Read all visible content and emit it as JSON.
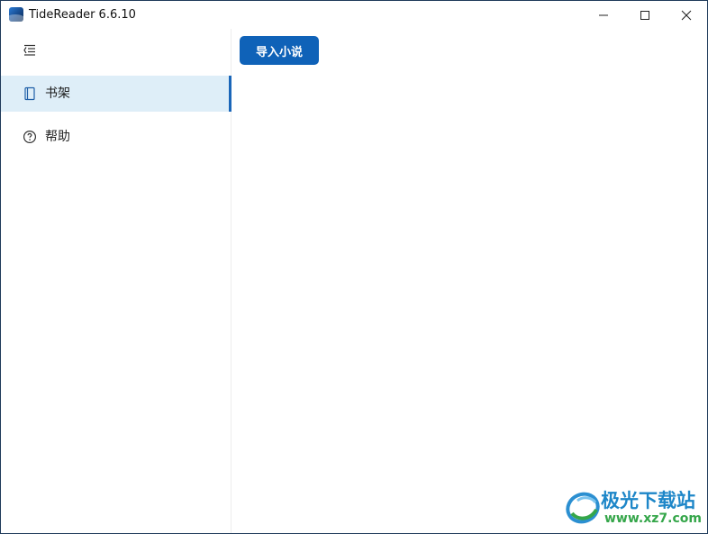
{
  "window": {
    "title": "TideReader 6.6.10"
  },
  "titlebar_icons": {
    "app": "tidereader-logo-icon",
    "minimize": "minimize-icon",
    "maximize": "maximize-icon",
    "close": "close-icon"
  },
  "sidebar": {
    "toggle_icon": "menu-collapse-icon",
    "items": [
      {
        "label": "书架",
        "icon": "book-icon",
        "selected": true
      },
      {
        "label": "帮助",
        "icon": "help-circle-icon",
        "selected": false
      }
    ]
  },
  "main": {
    "import_button_label": "导入小说"
  },
  "watermark": {
    "name": "极光下载站",
    "url": "www.xz7.com"
  },
  "colors": {
    "accent": "#0f62b8",
    "selected_bg": "#deeef8",
    "selected_indicator": "#1a66b9",
    "watermark_blue": "#1d86c8",
    "watermark_green": "#35a64a"
  }
}
